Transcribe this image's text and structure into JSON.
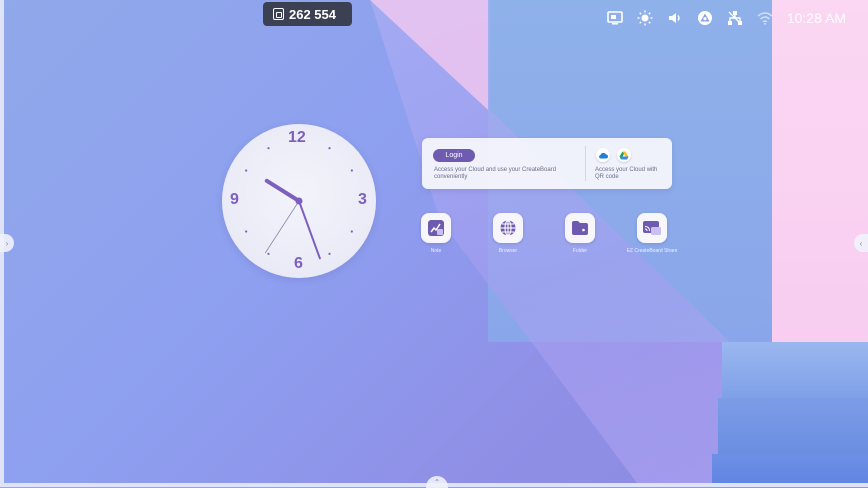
{
  "top_badge": {
    "icon": "screen-share-code-icon",
    "code": "262 554"
  },
  "status_bar": {
    "icons": [
      "display-icon",
      "brightness-icon",
      "volume-icon",
      "cloud-sync-icon",
      "network-icon",
      "wifi-icon"
    ],
    "time": "10:28 AM"
  },
  "clock": {
    "numbers": {
      "twelve": "12",
      "three": "3",
      "six": "6",
      "nine": "9"
    },
    "hands": {
      "hour": 10,
      "minute": 28,
      "second": 35
    }
  },
  "login_card": {
    "login_label": "Login",
    "description": "Access your Cloud and use your CreateBoard conveniently",
    "cloud_icons": [
      "onedrive-icon",
      "google-drive-icon"
    ],
    "qr_description": "Access your Cloud with QR code"
  },
  "apps": [
    {
      "label": "Note",
      "icon": "note-icon"
    },
    {
      "label": "Browser",
      "icon": "browser-icon"
    },
    {
      "label": "Folder",
      "icon": "folder-icon"
    },
    {
      "label": "EZ CreateBoard Share",
      "icon": "screen-share-icon"
    }
  ],
  "colors": {
    "accent": "#7d5fbd",
    "badge_bg": "#3b4152",
    "login_button": "#6f5cb0"
  }
}
